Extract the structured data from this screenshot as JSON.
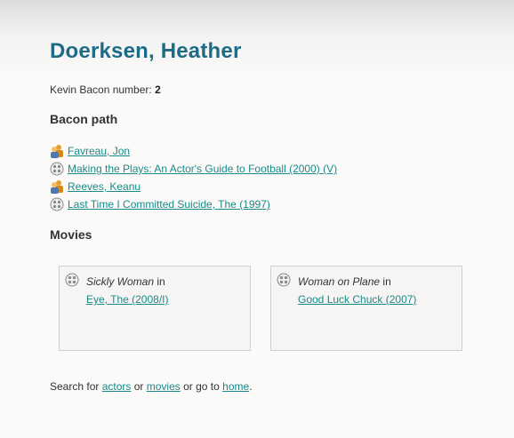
{
  "person": {
    "name": "Doerksen, Heather"
  },
  "bacon": {
    "label": "Kevin Bacon number:",
    "number": "2"
  },
  "path": {
    "heading": "Bacon path",
    "items": [
      {
        "type": "actor",
        "icon": "actor-icon",
        "label": "Favreau, Jon"
      },
      {
        "type": "movie",
        "icon": "film-reel-icon",
        "label": "Making the Plays: An Actor's Guide to Football (2000) (V)"
      },
      {
        "type": "actor",
        "icon": "actor-icon",
        "label": "Reeves, Keanu"
      },
      {
        "type": "movie",
        "icon": "film-reel-icon",
        "label": "Last Time I Committed Suicide, The (1997)"
      }
    ]
  },
  "movies": {
    "heading": "Movies",
    "items": [
      {
        "role": "Sickly Woman",
        "in_text": "in",
        "title": "Eye, The (2008/I)"
      },
      {
        "role": "Woman on Plane",
        "in_text": "in",
        "title": "Good Luck Chuck (2007)"
      }
    ]
  },
  "footer": {
    "prefix": "Search for",
    "actors_link": "actors",
    "or_text": "or",
    "movies_link": "movies",
    "goto_text": "or go to",
    "home_link": "home",
    "suffix": "."
  }
}
